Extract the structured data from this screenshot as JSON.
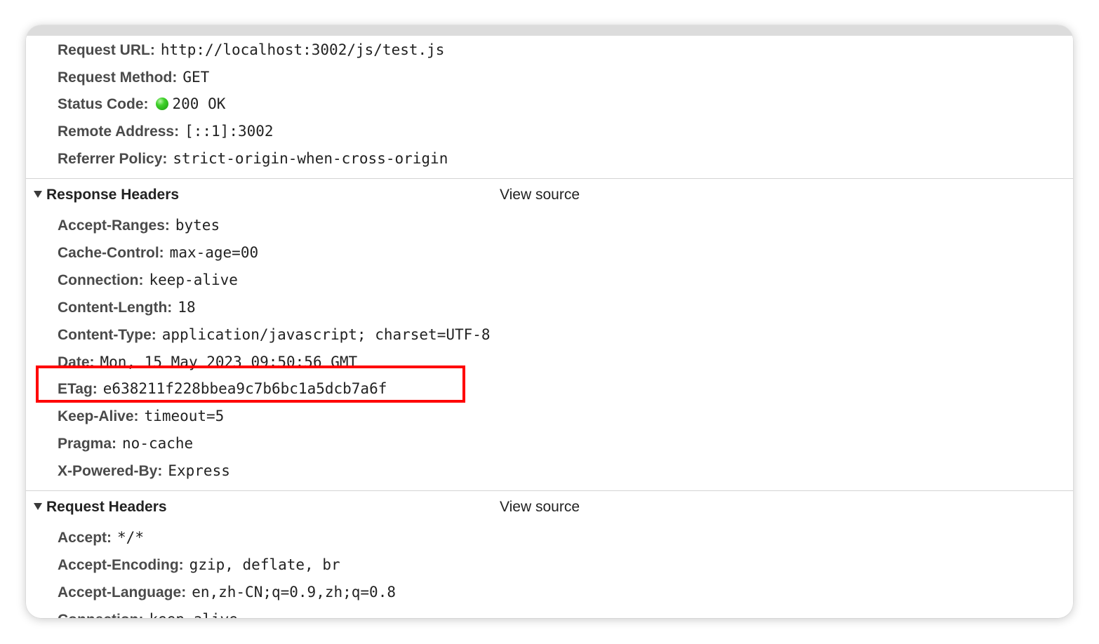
{
  "general": [
    {
      "key": "Request URL:",
      "value": "http://localhost:3002/js/test.js"
    },
    {
      "key": "Request Method:",
      "value": "GET"
    },
    {
      "key": "Status Code:",
      "value": "200 OK",
      "status_color": "#2ecc1f"
    },
    {
      "key": "Remote Address:",
      "value": "[::1]:3002"
    },
    {
      "key": "Referrer Policy:",
      "value": "strict-origin-when-cross-origin"
    }
  ],
  "response_headers": {
    "title": "Response Headers",
    "view_source": "View source",
    "items": [
      {
        "key": "Accept-Ranges:",
        "value": "bytes"
      },
      {
        "key": "Cache-Control:",
        "value": "max-age=00"
      },
      {
        "key": "Connection:",
        "value": "keep-alive"
      },
      {
        "key": "Content-Length:",
        "value": "18"
      },
      {
        "key": "Content-Type:",
        "value": "application/javascript; charset=UTF-8"
      },
      {
        "key": "Date:",
        "value": "Mon, 15 May 2023 09:50:56 GMT"
      },
      {
        "key": "ETag:",
        "value": "e638211f228bbea9c7b6bc1a5dcb7a6f"
      },
      {
        "key": "Keep-Alive:",
        "value": "timeout=5"
      },
      {
        "key": "Pragma:",
        "value": "no-cache"
      },
      {
        "key": "X-Powered-By:",
        "value": "Express"
      }
    ]
  },
  "request_headers": {
    "title": "Request Headers",
    "view_source": "View source",
    "items": [
      {
        "key": "Accept:",
        "value": "*/*"
      },
      {
        "key": "Accept-Encoding:",
        "value": "gzip, deflate, br"
      },
      {
        "key": "Accept-Language:",
        "value": "en,zh-CN;q=0.9,zh;q=0.8"
      },
      {
        "key": "Connection:",
        "value": "keep-alive"
      }
    ]
  },
  "highlight_color": "#ff0000"
}
